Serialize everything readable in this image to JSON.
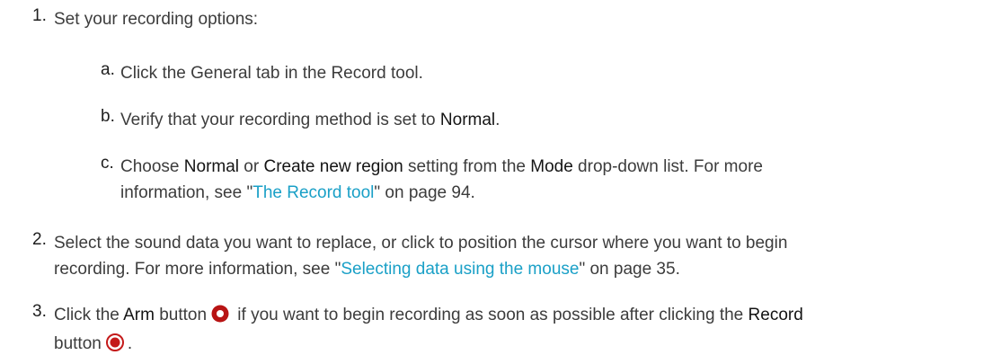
{
  "step1": {
    "number": "1.",
    "text": "Set your recording options:"
  },
  "step1a": {
    "letter": "a.",
    "text": "Click the General tab in the Record tool."
  },
  "step1b": {
    "letter": "b.",
    "pre": "Verify that your recording method is set to ",
    "bold": "Normal",
    "post": "."
  },
  "step1c": {
    "letter": "c.",
    "pre": "Choose ",
    "ui1": "Normal",
    "mid1": " or ",
    "ui2": "Create new region",
    "mid2": " setting from the ",
    "ui3": "Mode",
    "mid3": " drop-down list. For more",
    "line2_pre": "information, see \"",
    "link": "The Record tool",
    "line2_post": "\" on page 94."
  },
  "step2": {
    "number": "2.",
    "line1": "Select the sound data you want to replace, or click to position the cursor where you want to begin",
    "line2_pre": "recording. For more information, see \"",
    "link": "Selecting data using the mouse",
    "line2_post": "\" on page 35."
  },
  "step3": {
    "number": "3.",
    "pre": "Click the ",
    "ui1": "Arm",
    "mid1": " button",
    "mid2": " if you want to begin recording as soon as possible after clicking the ",
    "ui2": "Record",
    "line2_pre": "button",
    "line2_post": ".",
    "arm_icon": "arm-icon",
    "record_icon": "record-icon"
  },
  "colors": {
    "text": "#3c3c3c",
    "link": "#1aa0c7",
    "icon_red": "#c41a1a"
  }
}
